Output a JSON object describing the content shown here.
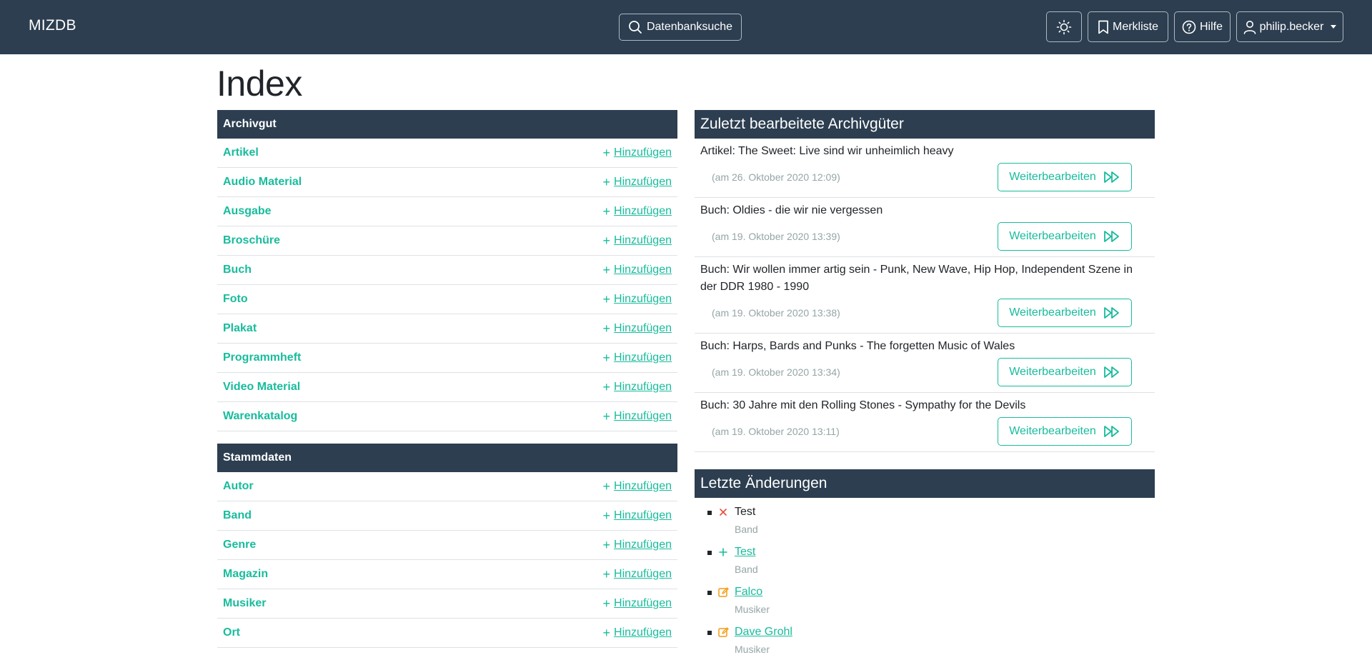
{
  "navbar": {
    "brand": "MIZDB",
    "search_label": "Datenbanksuche",
    "watchlist_label": "Merkliste",
    "help_label": "Hilfe",
    "user_label": "philip.becker",
    "theme_icon": "sun-icon"
  },
  "page": {
    "title": "Index"
  },
  "archivgut": {
    "title": "Archivgut",
    "add_label": "Hinzufügen",
    "items": [
      {
        "label": "Artikel"
      },
      {
        "label": "Audio Material"
      },
      {
        "label": "Ausgabe"
      },
      {
        "label": "Broschüre"
      },
      {
        "label": "Buch"
      },
      {
        "label": "Foto"
      },
      {
        "label": "Plakat"
      },
      {
        "label": "Programmheft"
      },
      {
        "label": "Video Material"
      },
      {
        "label": "Warenkatalog"
      }
    ]
  },
  "stammdaten": {
    "title": "Stammdaten",
    "add_label": "Hinzufügen",
    "items": [
      {
        "label": "Autor"
      },
      {
        "label": "Band"
      },
      {
        "label": "Genre"
      },
      {
        "label": "Magazin"
      },
      {
        "label": "Musiker"
      },
      {
        "label": "Ort"
      }
    ]
  },
  "recent": {
    "title": "Zuletzt bearbeitete Archivgüter",
    "button_label": "Weiterbearbeiten",
    "items": [
      {
        "title": "Artikel: The Sweet: Live sind wir unheimlich heavy",
        "date": "(am 26. Oktober 2020 12:09)"
      },
      {
        "title": "Buch: Oldies - die wir nie vergessen",
        "date": "(am 19. Oktober 2020 13:39)"
      },
      {
        "title": "Buch: Wir wollen immer artig sein - Punk, New Wave, Hip Hop, Independent Szene in der DDR 1980 - 1990",
        "date": "(am 19. Oktober 2020 13:38)"
      },
      {
        "title": "Buch: Harps, Bards and Punks - The forgetten Music of Wales",
        "date": "(am 19. Oktober 2020 13:34)"
      },
      {
        "title": "Buch: 30 Jahre mit den Rolling Stones - Sympathy for the Devils",
        "date": "(am 19. Oktober 2020 13:11)"
      }
    ]
  },
  "changes": {
    "title": "Letzte Änderungen",
    "items": [
      {
        "action": "delete",
        "icon": "x-icon",
        "title": "Test",
        "type": "Band",
        "linked": false,
        "color": "#e74c3c"
      },
      {
        "action": "add",
        "icon": "plus-icon",
        "title": "Test",
        "type": "Band",
        "linked": true,
        "color": "#18bc9c"
      },
      {
        "action": "edit",
        "icon": "edit-icon",
        "title": "Falco",
        "type": "Musiker",
        "linked": true,
        "color": "#f39c12"
      },
      {
        "action": "edit",
        "icon": "edit-icon",
        "title": "Dave Grohl",
        "type": "Musiker",
        "linked": true,
        "color": "#f39c12"
      }
    ]
  },
  "colors": {
    "navbar": "#2c3e50",
    "accent": "#18bc9c",
    "muted": "#95a5a6"
  }
}
